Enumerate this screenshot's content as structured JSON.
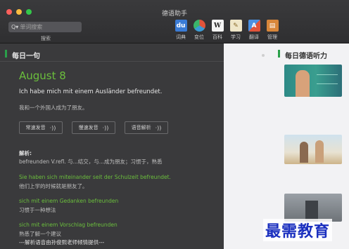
{
  "window": {
    "title": "德语助手"
  },
  "search": {
    "placeholder": "单词搜索",
    "label": "搜索"
  },
  "toolbar": {
    "tools": [
      {
        "label": "词典",
        "icon": "dictionary-icon",
        "color": "#3a7bd5",
        "glyph": "du"
      },
      {
        "label": "变位",
        "icon": "conjugation-icon",
        "color": "#e0533a",
        "glyph": ""
      },
      {
        "label": "百科",
        "icon": "wikipedia-icon",
        "color": "#f4f4f4",
        "glyph": "W"
      },
      {
        "label": "学习",
        "icon": "study-icon",
        "color": "#efe6c8",
        "glyph": "✎"
      },
      {
        "label": "翻译",
        "icon": "translate-icon",
        "color": "#4a90e2",
        "glyph": "A"
      },
      {
        "label": "管理",
        "icon": "manage-icon",
        "color": "#d8863a",
        "glyph": "▤"
      }
    ]
  },
  "daily": {
    "section_title": "每日一句",
    "date": "August 8",
    "sentence_de": "Ich habe mich mit einem Ausländer befreundet.",
    "sentence_cn": "我和一个外国人成为了朋友。",
    "buttons": [
      "常速发音",
      "慢速发音",
      "语音解析"
    ],
    "analysis_title": "解析:",
    "analysis_text": "befreunden V.refl. 与...结交，与...成为朋友；习惯于，熟悉",
    "examples": [
      {
        "de": "Sie haben sich miteinander seit der Schulzeit befreundet.",
        "cn": "他们上学的时候就是朋友了。"
      },
      {
        "de": "sich mit einem Gedanken befreunden",
        "cn": "习惯于一种想法"
      },
      {
        "de": "sich mit einem Vorschlag befreunden",
        "cn": "熟悉了解一个建议"
      }
    ],
    "credit": "---解析语音由孙俊熙老师倾情提供---"
  },
  "listening": {
    "section_title": "每日德语听力"
  },
  "watermark": "最需教育",
  "colors": {
    "accent": "#6bbf3c",
    "bar": "#2aa04a"
  }
}
